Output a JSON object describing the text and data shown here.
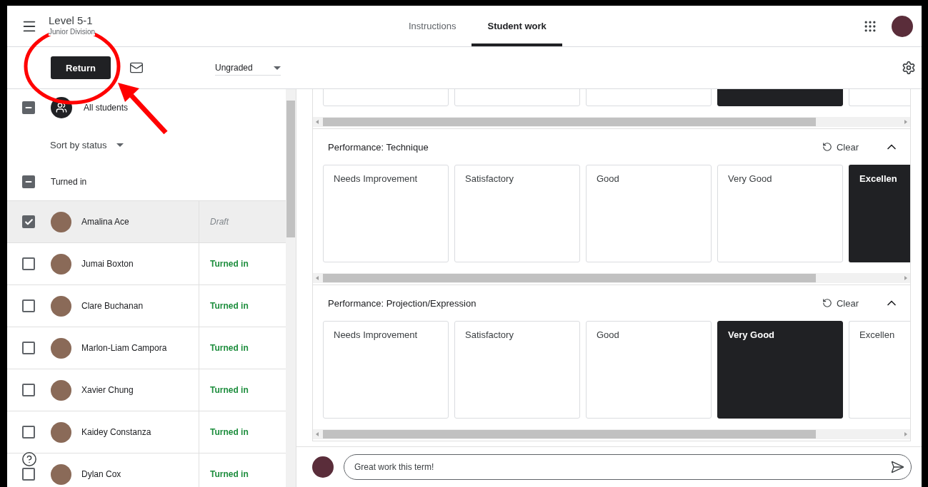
{
  "header": {
    "title": "Level 5-1",
    "subtitle": "Junior Division"
  },
  "tabs": [
    {
      "label": "Instructions",
      "selected": false
    },
    {
      "label": "Student work",
      "selected": true
    }
  ],
  "toolbar": {
    "return_button": "Return",
    "grade_select": {
      "value": "Ungraded"
    }
  },
  "class_list": {
    "all_students": {
      "label": "All students",
      "indeterminate": true
    },
    "sort": {
      "value": "Sort by status"
    },
    "group": {
      "label": "Turned in",
      "indeterminate": true
    },
    "students": [
      {
        "name": "Amalina Ace",
        "status": "Draft",
        "kind": "draft",
        "checked": true,
        "selected": true
      },
      {
        "name": "Jumai Boxton",
        "status": "Turned in",
        "kind": "turned",
        "checked": false,
        "selected": false
      },
      {
        "name": "Clare Buchanan",
        "status": "Turned in",
        "kind": "turned",
        "checked": false,
        "selected": false
      },
      {
        "name": "Marlon-Liam Campora",
        "status": "Turned in",
        "kind": "turned",
        "checked": false,
        "selected": false
      },
      {
        "name": "Xavier Chung",
        "status": "Turned in",
        "kind": "turned",
        "checked": false,
        "selected": false
      },
      {
        "name": "Kaidey Constanza",
        "status": "Turned in",
        "kind": "turned",
        "checked": false,
        "selected": false
      },
      {
        "name": "Dylan Cox",
        "status": "Turned in",
        "kind": "turned",
        "checked": false,
        "selected": false
      }
    ]
  },
  "rubric": {
    "criteria": [
      {
        "levels": [
          {
            "selected": false
          },
          {
            "selected": false
          },
          {
            "selected": false
          },
          {
            "selected": true
          },
          {
            "selected": false
          }
        ]
      },
      {
        "title": "Performance: Technique",
        "clear": "Clear",
        "expanded": true,
        "levels": [
          {
            "label": "Needs Improvement",
            "selected": false
          },
          {
            "label": "Satisfactory",
            "selected": false
          },
          {
            "label": "Good",
            "selected": false
          },
          {
            "label": "Very Good",
            "selected": false
          },
          {
            "label": "Excellen",
            "selected": true
          }
        ]
      },
      {
        "title": "Performance: Projection/Expression",
        "clear": "Clear",
        "expanded": true,
        "levels": [
          {
            "label": "Needs Improvement",
            "selected": false
          },
          {
            "label": "Satisfactory",
            "selected": false
          },
          {
            "label": "Good",
            "selected": false
          },
          {
            "label": "Very Good",
            "selected": true
          },
          {
            "label": "Excellen",
            "selected": false
          }
        ]
      }
    ]
  },
  "comment": {
    "value": "Great work this term!"
  }
}
